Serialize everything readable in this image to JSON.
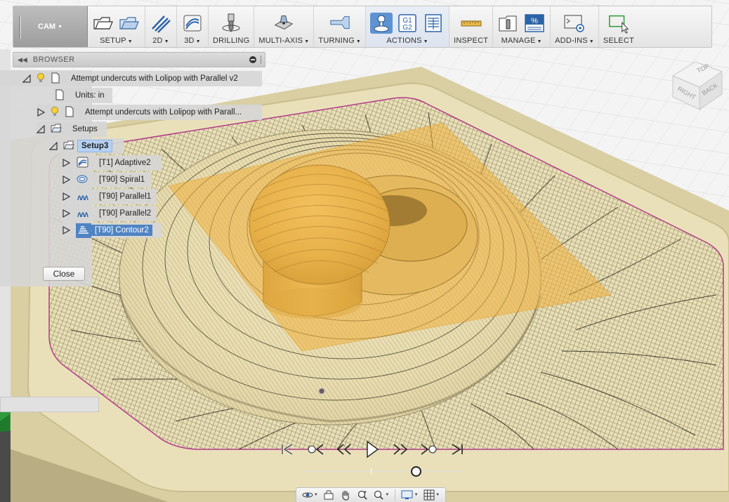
{
  "toolbar": {
    "workspace": "CAM",
    "groups": [
      {
        "label": "SETUP"
      },
      {
        "label": "2D"
      },
      {
        "label": "3D"
      },
      {
        "label": "DRILLING"
      },
      {
        "label": "MULTI-AXIS"
      },
      {
        "label": "TURNING"
      },
      {
        "label": "ACTIONS"
      },
      {
        "label": "INSPECT"
      },
      {
        "label": "MANAGE"
      },
      {
        "label": "ADD-INS"
      },
      {
        "label": "SELECT"
      }
    ],
    "g1g2_top": "G1",
    "g1g2_bottom": "G2"
  },
  "browser": {
    "title": "BROWSER",
    "items": [
      {
        "label": "Attempt undercuts with Lolipop with Parallel v2"
      },
      {
        "label": "Units: in"
      },
      {
        "label": "Attempt undercuts with Lolipop with Parall..."
      },
      {
        "label": "Setups"
      },
      {
        "label": "Setup3"
      },
      {
        "label": "[T1] Adaptive2"
      },
      {
        "label": "[T90] Spiral1"
      },
      {
        "label": "[T90] Parallel1"
      },
      {
        "label": "[T90] Parallel2"
      },
      {
        "label": "[T90] Contour2"
      }
    ],
    "close_label": "Close"
  },
  "viewcube": {
    "top": "TOP",
    "right": "RIGHT",
    "back": "BACK"
  },
  "timeline": {
    "progress": 0.72
  },
  "colors": {
    "selection_dark": "#4f84c4",
    "selection_light": "#b7d1f3",
    "stock": "#e6dcb4",
    "model_gold": "#e2b85c",
    "toolpath_plane": "#f1b03c"
  }
}
